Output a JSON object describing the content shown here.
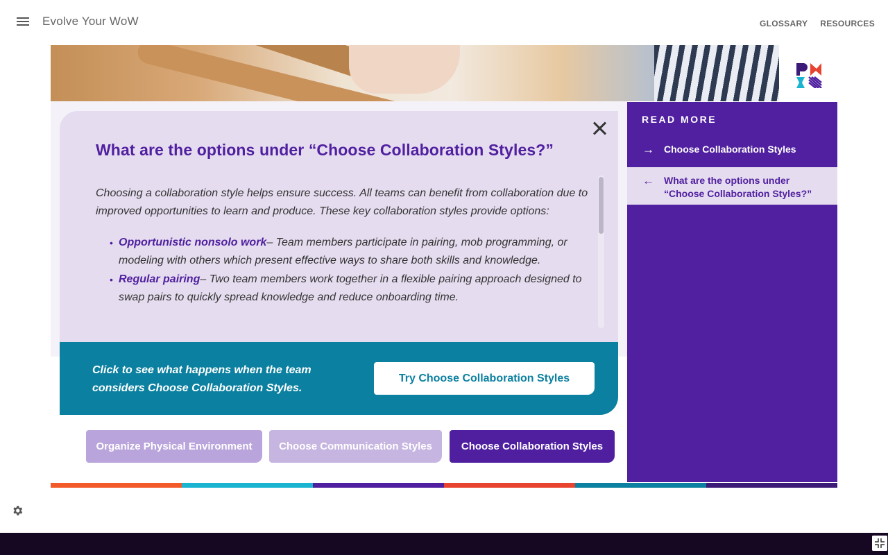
{
  "header": {
    "app_title": "Evolve Your WoW",
    "nav": [
      "GLOSSARY",
      "RESOURCES"
    ]
  },
  "card": {
    "title": "What are the options under “Choose Collaboration Styles?”",
    "intro": "Choosing a collaboration style helps ensure success. All teams can benefit from collaboration due to improved opportunities to learn and produce. These key collaboration styles provide options:",
    "bullets": [
      {
        "term": "Opportunistic nonsolo work",
        "text": "– Team members participate in pairing, mob programming, or modeling with others which present effective ways to share both skills and knowledge."
      },
      {
        "term": "Regular pairing",
        "text": "– Two team members work together in a flexible pairing approach designed to swap pairs to quickly spread knowledge and reduce onboarding time."
      }
    ],
    "scroll_position": 0.0
  },
  "cta": {
    "text": "Click to see what happens when the team considers Choose Collaboration Styles.",
    "button": "Try Choose Collaboration Styles"
  },
  "tabs": [
    {
      "label": "Organize Physical Environment",
      "active": false
    },
    {
      "label": "Choose Communication Styles",
      "active": false
    },
    {
      "label": "Choose Collaboration Styles",
      "active": true
    }
  ],
  "sidebar": {
    "title": "READ MORE",
    "links": [
      {
        "label": "Choose Collaboration Styles",
        "icon": "arrow-right-icon"
      },
      {
        "label": "What are the options under “Choose Collaboration Styles?”",
        "icon": "arrow-left-icon",
        "current": true
      }
    ]
  },
  "colors": {
    "brand_purple": "#5020a0",
    "card_bg": "#e5dcef",
    "teal": "#0b80a0",
    "strip": [
      "#f25a29",
      "#1ab3d0",
      "#4f1fa0",
      "#e8432f",
      "#0b80a0",
      "#3c1a78"
    ]
  }
}
